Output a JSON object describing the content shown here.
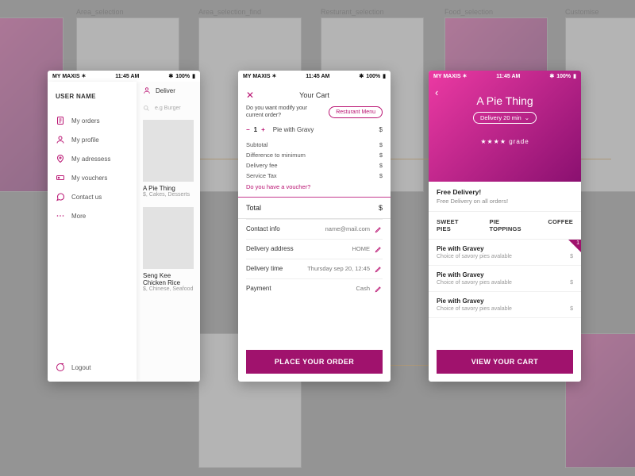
{
  "bg_labels": [
    "Area_selection",
    "Area_selection_find",
    "Resturant_selection",
    "Food_selection",
    "Customise"
  ],
  "status": {
    "carrier": "MY MAXIS",
    "time": "11:45 AM",
    "battery": "100%"
  },
  "screen1": {
    "username": "USER NAME",
    "menu": [
      {
        "icon": "orders",
        "label": "My orders"
      },
      {
        "icon": "profile",
        "label": "My profile"
      },
      {
        "icon": "addresses",
        "label": "My adressess"
      },
      {
        "icon": "vouchers",
        "label": "My vouchers"
      },
      {
        "icon": "contact",
        "label": "Contact us"
      },
      {
        "icon": "more",
        "label": "More"
      }
    ],
    "logout": "Logout",
    "deliver_label": "Deliver",
    "search_placeholder": "e.g Burger",
    "cards": [
      {
        "title": "A Pie Thing",
        "subtitle": "$, Cakes, Desserts"
      },
      {
        "title": "Seng Kee Chicken Rice",
        "subtitle": "$, Chinese, Seafood"
      }
    ]
  },
  "screen2": {
    "title": "Your Cart",
    "modify_prompt": "Do you want modify your current order?",
    "menu_button": "Resturant Menu",
    "qty": 1,
    "item": "Pie with Gravy",
    "currency": "$",
    "lines": [
      {
        "label": "Subtotal",
        "value": "$"
      },
      {
        "label": "Difference to minimum",
        "value": "$"
      },
      {
        "label": "Delivery fee",
        "value": "$"
      },
      {
        "label": "Service Tax",
        "value": "$"
      }
    ],
    "voucher_prompt": "Do you have a voucher?",
    "total_label": "Total",
    "total_value": "$",
    "edits": [
      {
        "label": "Contact info",
        "value": "name@mail.com"
      },
      {
        "label": "Delivery address",
        "value": "HOME"
      },
      {
        "label": "Delivery time",
        "value": "Thursday sep 20, 12:45"
      },
      {
        "label": "Payment",
        "value": "Cash"
      }
    ],
    "cta": "PLACE YOUR ORDER"
  },
  "screen3": {
    "title": "A Pie Thing",
    "delivery_chip": "Delivery 20 min",
    "rating_label": "★★★★ grade",
    "promo_title": "Free Delivery!",
    "promo_sub": "Free Delivery on all orders!",
    "categories": [
      "SWEET PIES",
      "PIE TOPPINGS",
      "COFFEE"
    ],
    "badge_count": 1,
    "items": [
      {
        "title": "Pie with Gravey",
        "subtitle": "Choice of savory pies avalable",
        "price": "$"
      },
      {
        "title": "Pie with Gravey",
        "subtitle": "Choice of savory pies avalable",
        "price": "$"
      },
      {
        "title": "Pie with Gravey",
        "subtitle": "Choice of savory pies avalable",
        "price": "$"
      }
    ],
    "cta": "VIEW YOUR CART"
  }
}
